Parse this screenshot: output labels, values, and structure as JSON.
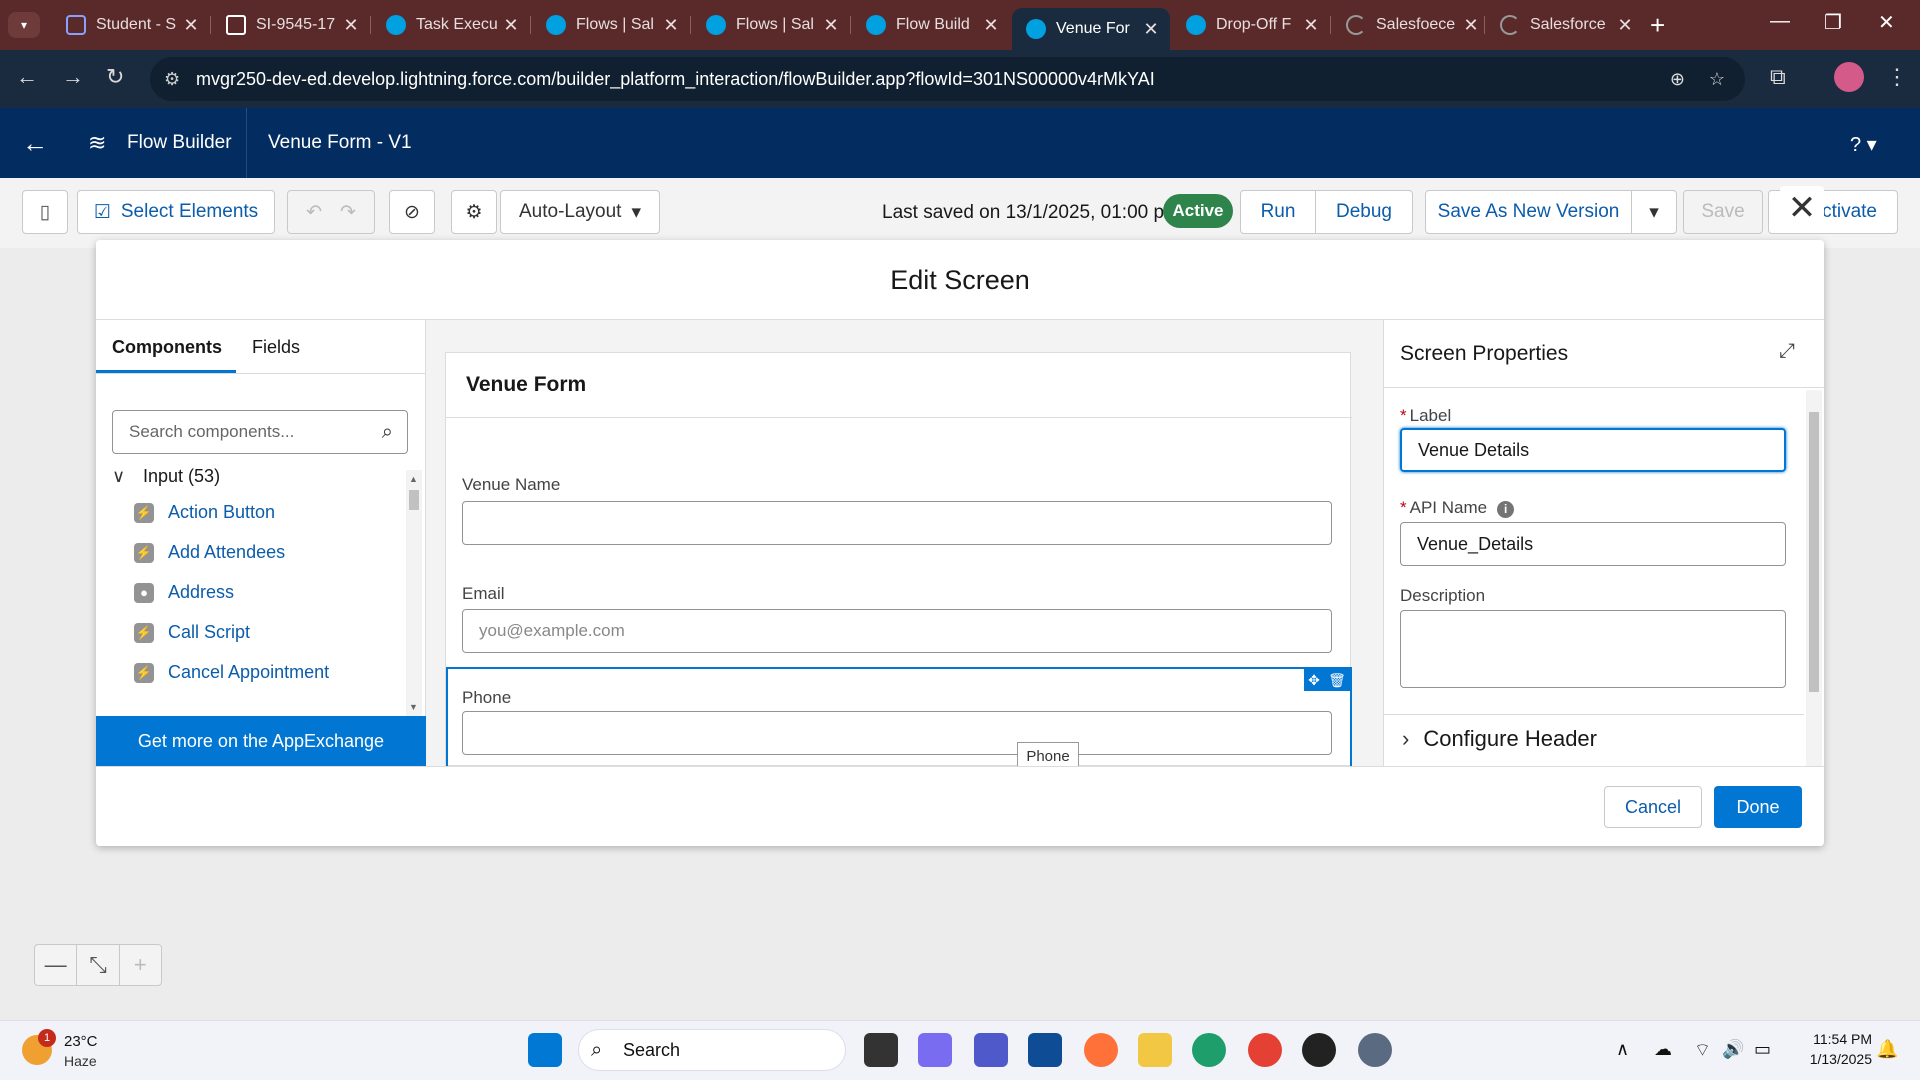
{
  "browser": {
    "tabs": [
      {
        "title": "Student - S",
        "icon": "student-icon"
      },
      {
        "title": "SI-9545-17",
        "icon": "doc-icon"
      },
      {
        "title": "Task Execu",
        "icon": "salesforce-cloud-icon"
      },
      {
        "title": "Flows | Sal",
        "icon": "salesforce-cloud-icon"
      },
      {
        "title": "Flows | Sal",
        "icon": "salesforce-cloud-icon"
      },
      {
        "title": "Flow Build",
        "icon": "salesforce-cloud-icon"
      },
      {
        "title": "Venue For",
        "icon": "salesforce-cloud-icon",
        "active": true
      },
      {
        "title": "Drop-Off F",
        "icon": "salesforce-cloud-icon"
      },
      {
        "title": "Salesfoece",
        "icon": "loading-icon"
      },
      {
        "title": "Salesforce",
        "icon": "loading-icon"
      }
    ],
    "url": "mvgr250-dev-ed.develop.lightning.force.com/builder_platform_interaction/flowBuilder.app?flowId=301NS00000v4rMkYAI"
  },
  "header": {
    "app_name": "Flow Builder",
    "flow_title": "Venue Form - V1",
    "help": "?"
  },
  "toolbar": {
    "select_elements": "Select Elements",
    "layout": "Auto-Layout",
    "last_saved": "Last saved on 13/1/2025, 01:00 pm",
    "status": "Active",
    "run": "Run",
    "debug": "Debug",
    "save_as_new_version": "Save As New Version",
    "save": "Save",
    "activate": "ctivate"
  },
  "modal": {
    "title": "Edit Screen",
    "left": {
      "tab_components": "Components",
      "tab_fields": "Fields",
      "search_placeholder": "Search components...",
      "group": "Input (53)",
      "items": [
        "Action Button",
        "Add Attendees",
        "Address",
        "Call Script",
        "Cancel Appointment"
      ],
      "appexchange": "Get more on the AppExchange"
    },
    "canvas": {
      "screen_title": "Venue Form",
      "fields": [
        {
          "label": "Venue Name",
          "placeholder": ""
        },
        {
          "label": "Email",
          "placeholder": "you@example.com"
        },
        {
          "label": "Phone",
          "placeholder": ""
        }
      ],
      "tooltip": "Phone"
    },
    "properties": {
      "title": "Screen Properties",
      "label_label": "Label",
      "label_value": "Venue Details",
      "api_name_label": "API Name",
      "api_name_value": "Venue_Details",
      "description_label": "Description",
      "configure_header": "Configure Header"
    },
    "cancel": "Cancel",
    "done": "Done"
  },
  "taskbar": {
    "weather_temp": "23°C",
    "weather_desc": "Haze",
    "weather_badge": "1",
    "search": "Search",
    "time": "11:54 PM",
    "date": "1/13/2025"
  },
  "colors": {
    "brand_blue": "#0176d3",
    "header_navy": "#032d60",
    "active_green": "#2e844a",
    "tabstrip": "#5a2a2a"
  }
}
